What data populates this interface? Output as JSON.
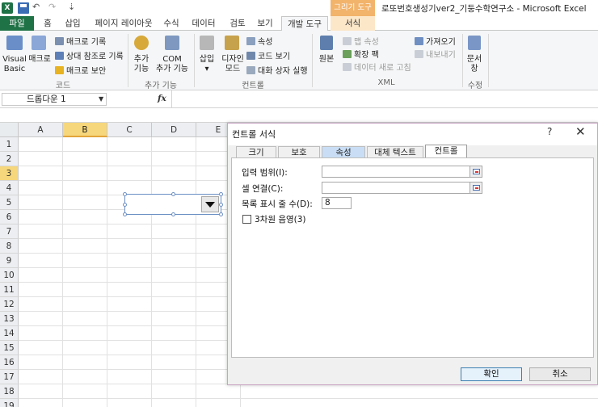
{
  "window": {
    "title": "로또번호생성기ver2_기둥수학연구소  -  Microsoft Excel",
    "context_tab_header": "그리기 도구",
    "app_icon_text": "X"
  },
  "quick_access": {
    "undo": "↶",
    "redo": "↷",
    "customize": "⇣"
  },
  "tabs": [
    "파일",
    "홈",
    "삽입",
    "페이지 레이아웃",
    "수식",
    "데이터",
    "검토",
    "보기",
    "개발 도구",
    "서식"
  ],
  "ribbon": {
    "code": {
      "visual_basic": [
        "Visual",
        "Basic"
      ],
      "macro": "매크로",
      "record_macro": "매크로 기록",
      "relative_ref": "상대 참조로 기록",
      "macro_security": "매크로 보안",
      "label": "코드"
    },
    "addins": {
      "addins": [
        "추가",
        "기능"
      ],
      "com": [
        "COM",
        "추가 기능"
      ],
      "label": "추가 기능"
    },
    "controls": {
      "insert": [
        "삽입",
        "▾"
      ],
      "design": [
        "디자인",
        "모드"
      ],
      "properties": "속성",
      "view_code": "코드 보기",
      "run_dialog": "대화 상자 실행",
      "label": "컨트롤"
    },
    "xml": {
      "source": "원본",
      "map_properties": "맵 속성",
      "expansion_packs": "확장 팩",
      "refresh_data": "데이터 새로 고침",
      "import": "가져오기",
      "export": "내보내기",
      "label": "XML"
    },
    "modify": {
      "document": [
        "문서",
        "창"
      ],
      "label": "수정"
    }
  },
  "formula_bar": {
    "name_box": "드롭다운 1",
    "fx": "fx",
    "formula": ""
  },
  "grid": {
    "columns": [
      "A",
      "B",
      "C",
      "D",
      "E"
    ],
    "rows": [
      "1",
      "2",
      "3",
      "4",
      "5",
      "6",
      "7",
      "8",
      "9",
      "10",
      "11",
      "12",
      "13",
      "14",
      "15",
      "16",
      "17",
      "18",
      "19"
    ],
    "active_column": "B",
    "active_row": "3"
  },
  "dialog": {
    "title": "컨트롤 서식",
    "help": "?",
    "close": "✕",
    "tabs": [
      "크기",
      "보호",
      "속성",
      "대체 텍스트",
      "컨트롤"
    ],
    "active_tab": "컨트롤",
    "hover_tab": "속성",
    "input_range_label": "입력 범위(I):",
    "input_range_value": "",
    "cell_link_label": "셀 연결(C):",
    "cell_link_value": "",
    "drop_lines_label": "목록 표시 줄 수(D):",
    "drop_lines_value": "8",
    "shading_label": "3차원 음영(3)",
    "ok": "확인",
    "cancel": "취소"
  },
  "colors": {
    "excel_green": "#1f7246",
    "active_header": "#f7d77b",
    "context_tab": "#f2b36b"
  }
}
